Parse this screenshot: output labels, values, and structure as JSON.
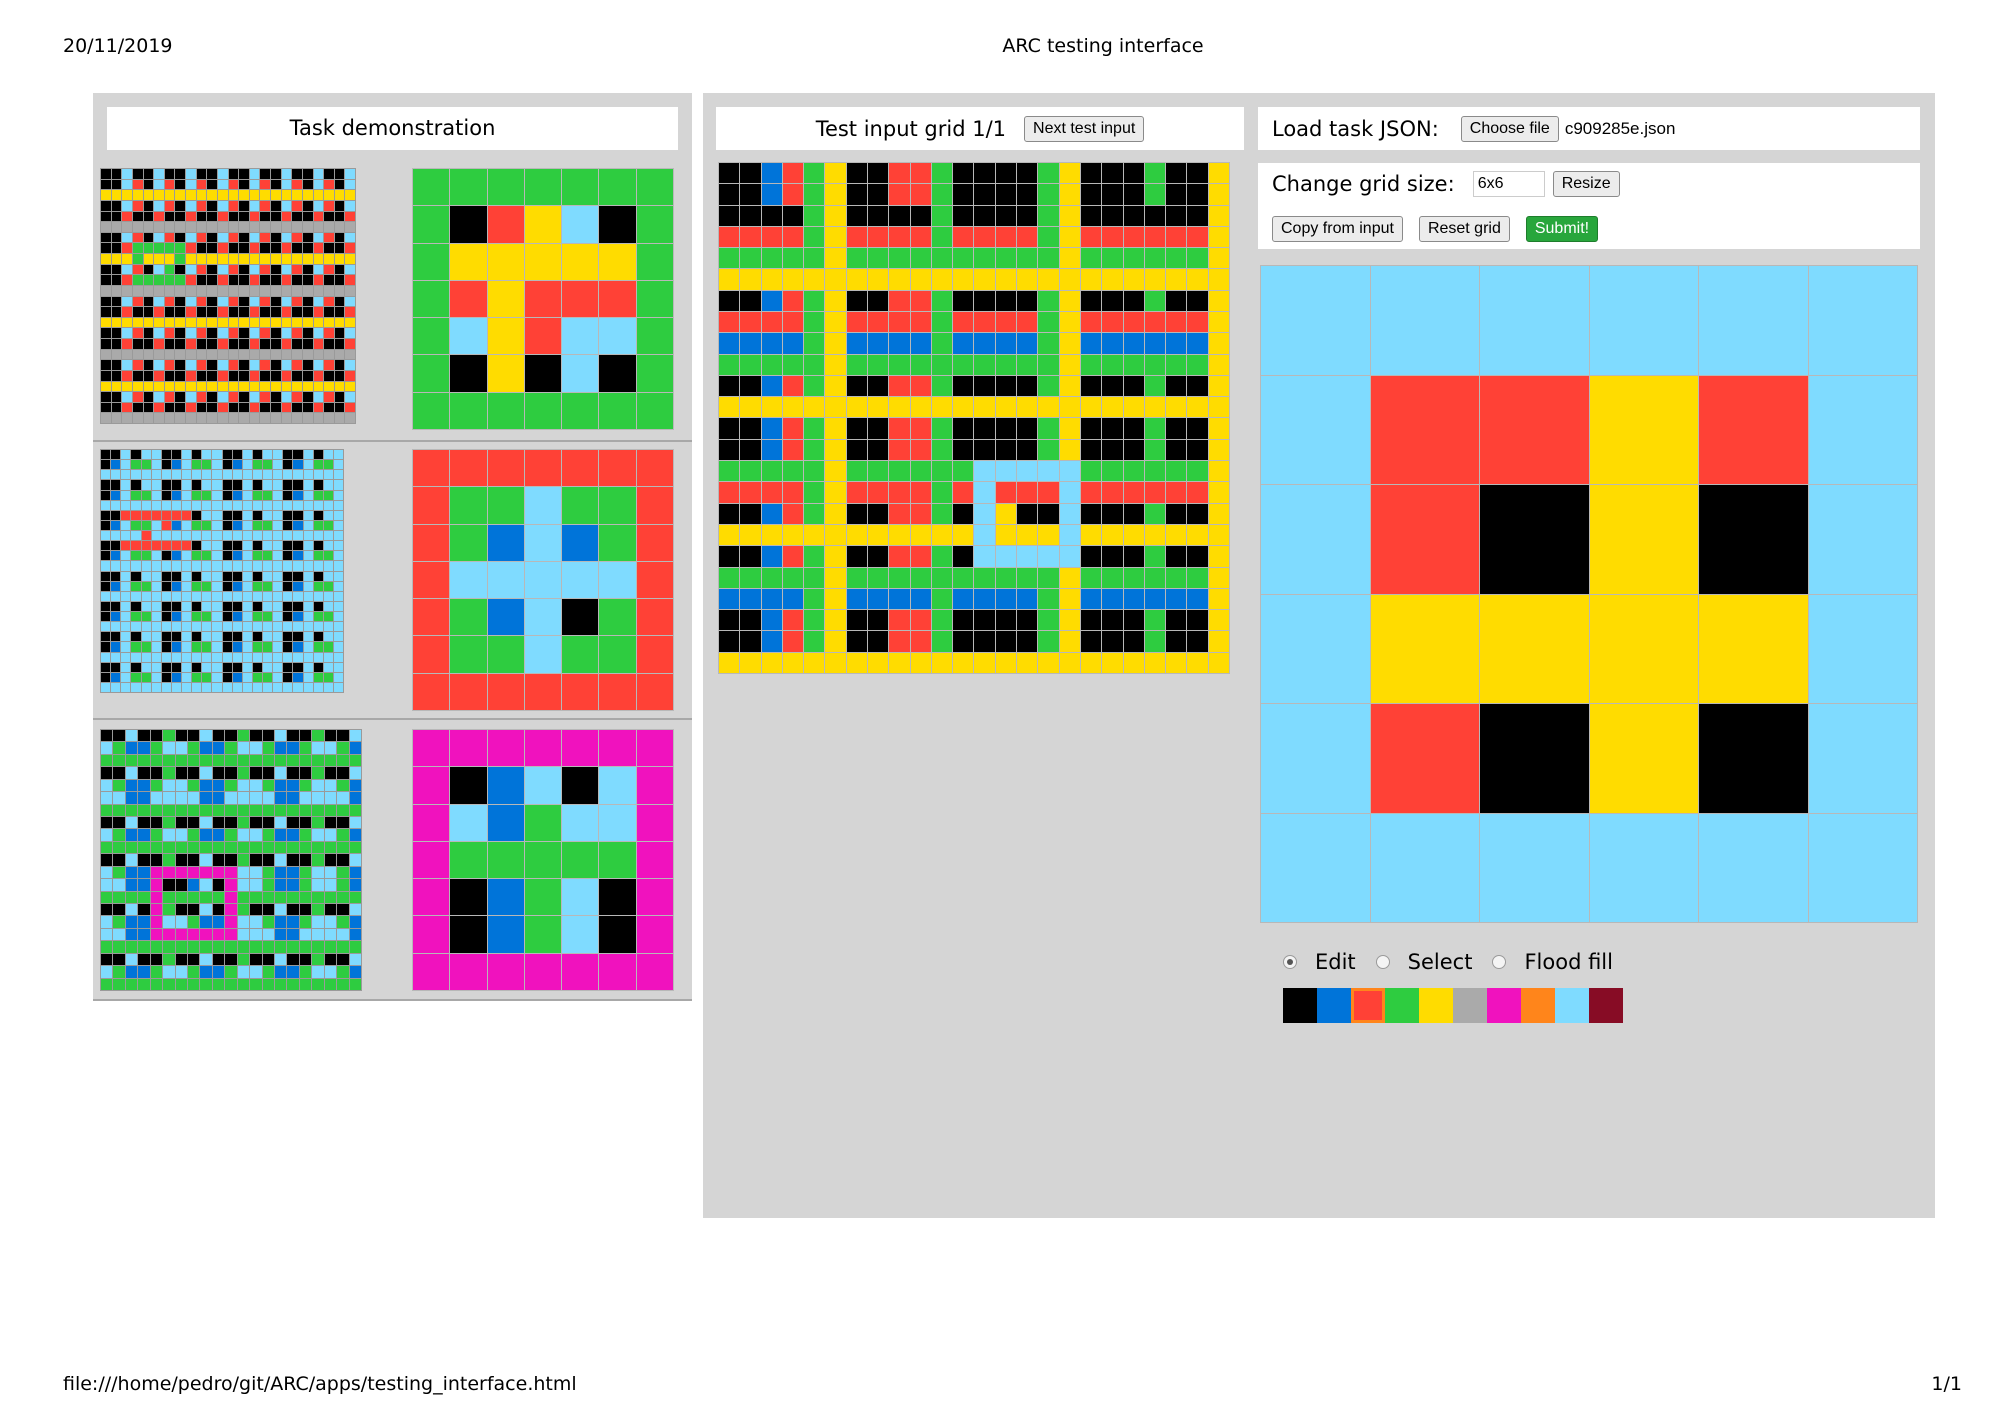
{
  "page": {
    "date": "20/11/2019",
    "title": "ARC testing interface",
    "footer_path": "file:///home/pedro/git/ARC/apps/testing_interface.html",
    "footer_page": "1/1"
  },
  "demo": {
    "header": "Task demonstration",
    "pairs": [
      {
        "input": [
          "008008008008008008008008",
          "008208208208208208208208",
          "444444444444444444444444",
          "008208208208208208208208",
          "002002002002002002002002",
          "555555555555555555555555",
          "008208208208208208208208",
          "002333332002002002002002",
          "444344434444444444444444",
          "008208308208208208208208",
          "002333332002002002002002",
          "555555555555555555555555",
          "008208208208208208208208",
          "002002002002002002002002",
          "444444444444444444444444",
          "008208208208208208208208",
          "002002002002002002002002",
          "555555555555555555555555",
          "008208208208208208208208",
          "002002002002002002002002",
          "444444444444444444444444",
          "008208208208208208208208",
          "002002002002002002002002",
          "555555555555555555555555"
        ],
        "output": [
          "3333333",
          "3024803",
          "3444443",
          "3242223",
          "3842883",
          "3040803",
          "3333333"
        ]
      },
      {
        "input": [
          "008088008088008088008088",
          "018338018338018338018338",
          "888888888888888888888888",
          "008088008088008088008088",
          "018338018338018338018338",
          "888888888888888888888888",
          "002222222088008088008088",
          "018338218338018338018338",
          "888828888888888888888888",
          "002222222088008088008088",
          "018338018338018338018338",
          "888888888888888888888888",
          "008088008088008088008088",
          "018338018338018338018338",
          "888888888888888888888888",
          "008088008088008088008088",
          "018338018338018338018338",
          "888888888888888888888888",
          "008088008088008088008088",
          "018338018338018338018338",
          "888888888888888888888888",
          "008088008088008088008088",
          "018338018338018338018338",
          "888888888888888888888888"
        ],
        "output": [
          "2222222",
          "2338332",
          "2318132",
          "2888882",
          "2318032",
          "2338332",
          "2222222"
        ]
      },
      {
        "input": [
          "008003008003008003008",
          "831138831138831138831",
          "333333333333333333333",
          "008003008003008003008",
          "831138831138831138831",
          "881188881188881188881",
          "333333333333333333333",
          "008003008003008003008",
          "831138831138831138831",
          "333333333333333333333",
          "008003008003008003008",
          "831166666668831138831",
          "881160018068831138831",
          "333363333363333333333",
          "008063008063008003008",
          "831168831168831138831",
          "881166666668881188881",
          "333333333333333333333",
          "008003008003008003008",
          "831138831138831138831",
          "333333333333333333333"
        ],
        "output": [
          "6666666",
          "6018086",
          "6813886",
          "6333336",
          "6013806",
          "6013806",
          "6666666"
        ]
      }
    ]
  },
  "test": {
    "header": "Test input grid 1/1",
    "next_button": "Next test input",
    "input": [
      "001234002230000340003004",
      "001234002230000340003004",
      "000034000030000340000004",
      "222234222232222342222224",
      "333334333333333343333334",
      "444444444444444444444444",
      "001234002230000340003004",
      "222234222232222342222224",
      "111134111131111341111114",
      "333334333333333343333334",
      "001234002230000340003004",
      "444444444444444444444444",
      "001234002230000340003004",
      "001234002230000340003004",
      "333334333333888883333334",
      "222234222232822282222224",
      "001234002230840080003004",
      "444444444444844484444444",
      "001234002230888880003004",
      "333334333333333343333334",
      "111134111131111341111114",
      "001234002230000340003004",
      "001234002230000340003004",
      "444444444444444444444444"
    ]
  },
  "controls": {
    "load_label": "Load task JSON:",
    "choose_file": "Choose file",
    "file_name": "c909285e.json",
    "grid_size_label": "Change grid size:",
    "grid_size_value": "6x6",
    "resize": "Resize",
    "copy_from_input": "Copy from input",
    "reset_grid": "Reset grid",
    "submit": "Submit!"
  },
  "output_grid": [
    "888888",
    "822428",
    "820408",
    "844448",
    "820408",
    "888888"
  ],
  "tool_modes": {
    "selected": "edit",
    "options": [
      {
        "id": "edit",
        "label": "Edit"
      },
      {
        "id": "select",
        "label": "Select"
      },
      {
        "id": "floodfill",
        "label": "Flood fill"
      }
    ]
  },
  "palette": {
    "selected_index": 2,
    "colors": [
      "#000000",
      "#0074D9",
      "#FF4136",
      "#2ECC40",
      "#FFDC00",
      "#AAAAAA",
      "#F012BE",
      "#FF851B",
      "#7FDBFF",
      "#870C25"
    ]
  }
}
